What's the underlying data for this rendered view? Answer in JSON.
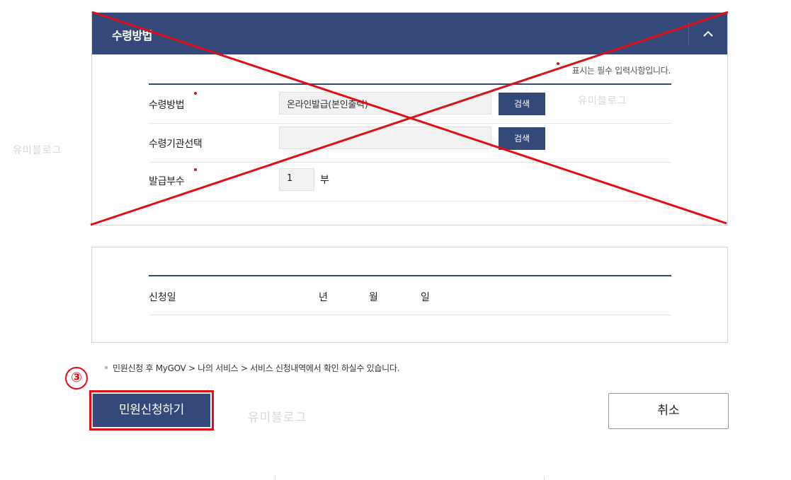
{
  "section": {
    "title": "수령방법",
    "collapse_icon": "chevron-up-icon",
    "required_note": "표시는 필수 입력사항입니다."
  },
  "form": {
    "receipt_method": {
      "label": "수령방법",
      "value": "온라인발급(본인출력)",
      "button": "검색"
    },
    "receipt_agency": {
      "label": "수령기관선택",
      "value": "",
      "button": "검색"
    },
    "copies": {
      "label": "발급부수",
      "value": "1",
      "unit": "부"
    }
  },
  "application_date": {
    "label": "신청일",
    "year_unit": "년",
    "month_unit": "월",
    "day_unit": "일"
  },
  "info_text": "민원신청 후 MyGOV > 나의 서비스 > 서비스 신청내역에서 확인 하실수 있습니다.",
  "step_marker": "③",
  "buttons": {
    "submit": "민원신청하기",
    "cancel": "취소"
  },
  "watermark": "유미블로그",
  "colors": {
    "header_navy": "#34497a",
    "annotation_red": "#e30d15"
  }
}
